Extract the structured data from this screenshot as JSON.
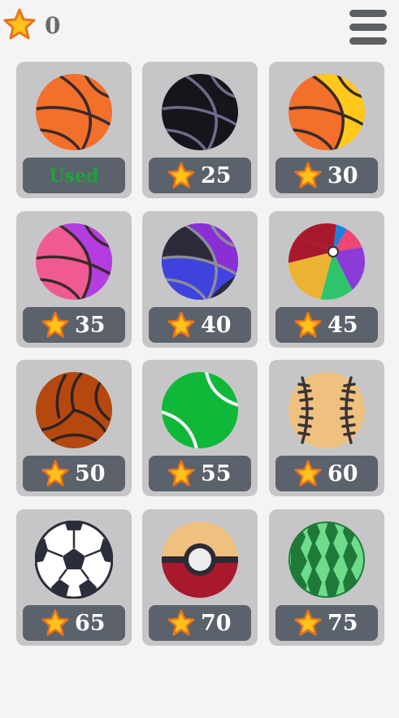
{
  "header": {
    "coins": "0"
  },
  "colors": {
    "card_bg": "#c6c6c8",
    "price_bg": "#5b626b",
    "star_fill": "#ffc21a",
    "star_outline": "#e9731c",
    "used_text": "#1fa33a"
  },
  "items": [
    {
      "ball": "orange-basketball-icon",
      "label": "Used",
      "used": true
    },
    {
      "ball": "black-basketball-icon",
      "label": "25"
    },
    {
      "ball": "orange-yellow-basketball-icon",
      "label": "30"
    },
    {
      "ball": "pink-purple-basketball-icon",
      "label": "35"
    },
    {
      "ball": "purple-blue-basketball-icon",
      "label": "40"
    },
    {
      "ball": "beach-ball-icon",
      "label": "45"
    },
    {
      "ball": "volleyball-icon",
      "label": "50"
    },
    {
      "ball": "tennis-ball-icon",
      "label": "55"
    },
    {
      "ball": "baseball-icon",
      "label": "60"
    },
    {
      "ball": "soccer-ball-icon",
      "label": "65"
    },
    {
      "ball": "pokeball-icon",
      "label": "70"
    },
    {
      "ball": "watermelon-ball-icon",
      "label": "75"
    }
  ]
}
